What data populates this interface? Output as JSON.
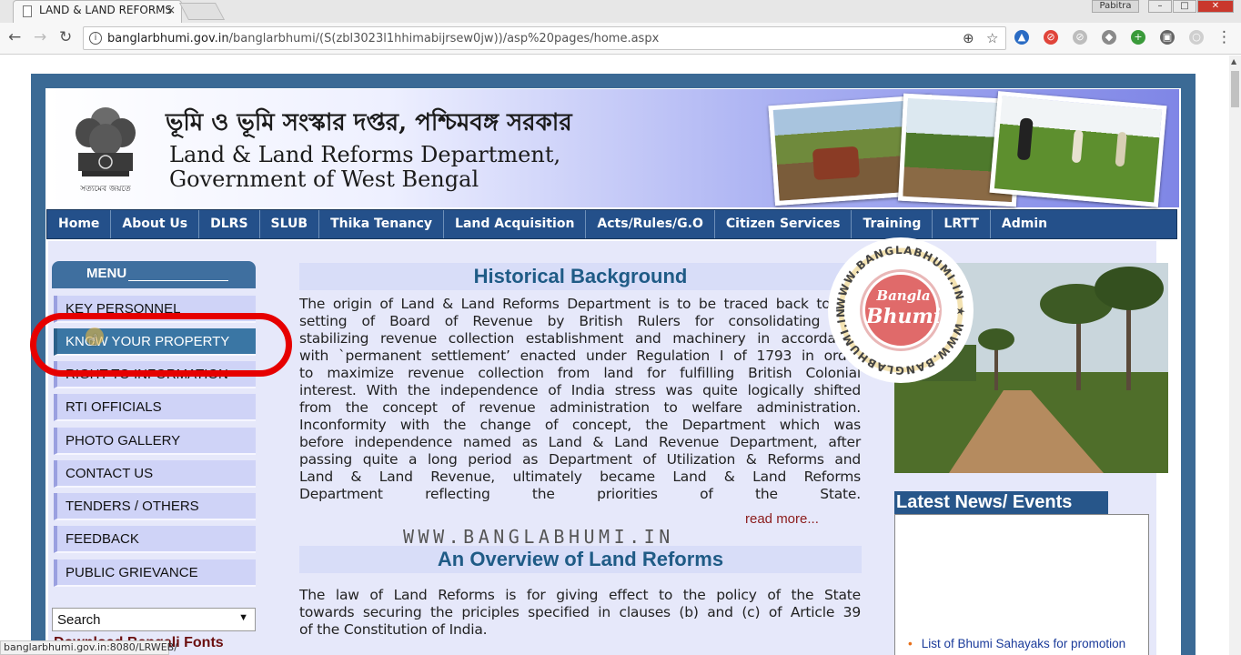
{
  "browser": {
    "tab_title": "LAND & LAND REFORMS",
    "tab_close": "×",
    "user_name": "Pabitra",
    "url_host": "banglarbhumi.gov.in",
    "url_path": "/banglarbhumi/(S(zbl3023l1hhimabijrsew0jw))/asp%20pages/home.aspx",
    "status_url": "banglarbhumi.gov.in:8080/LRWEB/"
  },
  "header": {
    "title_bengali": "ভূমি ও ভূমি সংস্কার দপ্তর, পশ্চিমবঙ্গ সরকার",
    "title_line1": "Land & Land Reforms Department,",
    "title_line2": "Government of West Bengal",
    "emblem_motto": "সত্যমেব জয়তে"
  },
  "nav": {
    "items": [
      "Home",
      "About Us",
      "DLRS",
      "SLUB",
      "Thika Tenancy",
      "Land Acquisition",
      "Acts/Rules/G.O",
      "Citizen Services",
      "Training",
      "LRTT",
      "Admin"
    ]
  },
  "menu": {
    "heading": "MENU",
    "items": [
      "KEY PERSONNEL",
      "KNOW YOUR PROPERTY",
      "RIGHT TO INFORMATION",
      "RTI OFFICIALS",
      "PHOTO GALLERY",
      "CONTACT US",
      "TENDERS / OTHERS",
      "FEEDBACK",
      "PUBLIC GRIEVANCE"
    ],
    "search_value": "Search",
    "download_fonts": "Download Bengali Fonts"
  },
  "main": {
    "section1_title": "Historical Background",
    "section1_lines": [
      "The origin of Land & Land Reforms Department is to be traced back to the",
      "setting of Board of Revenue by British Rulers for consolidating and",
      "stabilizing revenue collection establishment and machinery in accordance",
      "with `permanent settlement’ enacted under Regulation I of 1793 in order",
      "to maximize revenue collection from land for fulfilling British Colonial",
      "interest. With the independence of India stress was quite logically shifted",
      "from the concept of revenue administration to welfare administration.",
      "Inconformity with the change of concept, the Department which was",
      "before independence named as Land & Land Revenue Department, after",
      "passing quite a long period as Department of Utilization & Reforms and",
      "Land & Land Revenue, ultimately became Land & Land Reforms",
      "Department reflecting the priorities of the State."
    ],
    "read_more": "read more...",
    "watermark": "WWW.BANGLABHUMI.IN",
    "section2_title": "An Overview of Land Reforms",
    "section2_lines": [
      "The law of Land Reforms is for giving effect to the policy of the State",
      "towards securing the priciples specified in clauses (b) and (c) of Article 39",
      "of the Constitution of India."
    ]
  },
  "stamp": {
    "ring_text": "WWW.BANGLABHUMI.IN ★ WWW.BANGLABHUMI.IN ★",
    "line1": "Bangla",
    "line2": "Bhumi"
  },
  "news": {
    "title": "Latest News/ Events",
    "items": [
      "List of Bhumi Sahayaks for promotion"
    ]
  },
  "colors": {
    "nav_bg": "#24508a",
    "frame_bg": "#3b6a95",
    "menu_active": "#3a76a4",
    "highlight_ring": "#e60000",
    "section_title": "#1f5b86"
  }
}
